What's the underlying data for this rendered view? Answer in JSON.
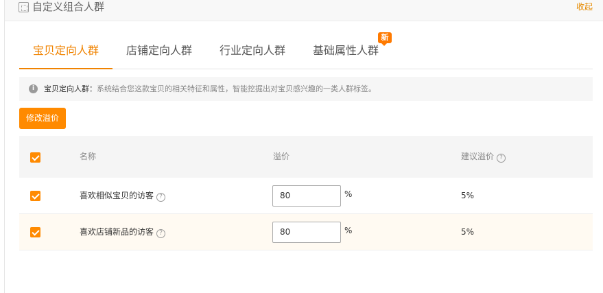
{
  "header": {
    "title": "自定义组合人群",
    "collapse_label": "收起"
  },
  "tabs": [
    {
      "label": "宝贝定向人群",
      "active": true
    },
    {
      "label": "店铺定向人群",
      "active": false
    },
    {
      "label": "行业定向人群",
      "active": false
    },
    {
      "label": "基础属性人群",
      "active": false,
      "badge": "新"
    }
  ],
  "tip": {
    "strong": "宝贝定向人群：",
    "text": "系统结合您这款宝贝的相关特征和属性，智能挖掘出对宝贝感兴趣的一类人群标签。"
  },
  "edit_button": "修改溢价",
  "table": {
    "columns": {
      "name": "名称",
      "premium": "溢价",
      "suggested": "建议溢价"
    },
    "header_checked": true,
    "rows": [
      {
        "name": "喜欢相似宝贝的访客",
        "premium": "80",
        "unit": "%",
        "suggested": "5%",
        "checked": true
      },
      {
        "name": "喜欢店铺新品的访客",
        "premium": "80",
        "unit": "%",
        "suggested": "5%",
        "checked": true
      }
    ]
  },
  "colors": {
    "accent": "#ff8a00",
    "tab_active": "#f08300",
    "link": "#e58a00"
  }
}
